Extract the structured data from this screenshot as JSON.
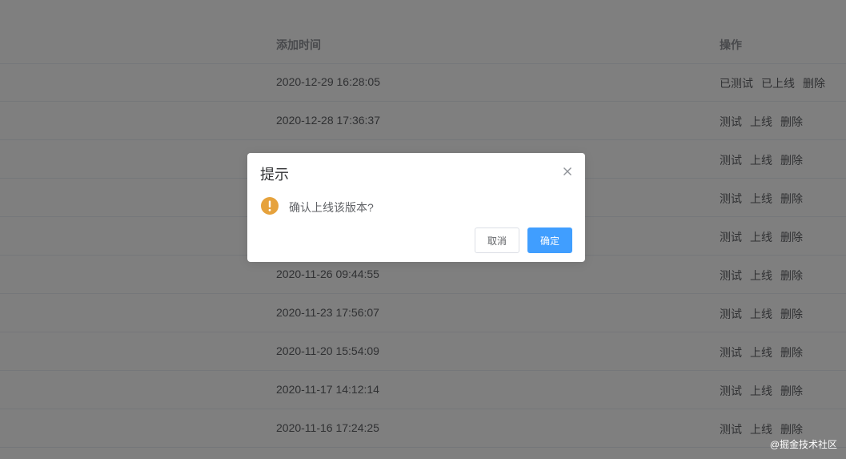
{
  "table": {
    "columns": {
      "time": "添加时间",
      "ops": "操作"
    },
    "rows": [
      {
        "time": "2020-12-29 16:28:05",
        "ops": [
          "已测试",
          "已上线",
          "删除"
        ]
      },
      {
        "time": "2020-12-28 17:36:37",
        "ops": [
          "测试",
          "上线",
          "删除"
        ]
      },
      {
        "time": "",
        "ops": [
          "测试",
          "上线",
          "删除"
        ]
      },
      {
        "time": "",
        "ops": [
          "测试",
          "上线",
          "删除"
        ]
      },
      {
        "time": "",
        "ops": [
          "测试",
          "上线",
          "删除"
        ]
      },
      {
        "time": "2020-11-26 09:44:55",
        "ops": [
          "测试",
          "上线",
          "删除"
        ]
      },
      {
        "time": "2020-11-23 17:56:07",
        "ops": [
          "测试",
          "上线",
          "删除"
        ]
      },
      {
        "time": "2020-11-20 15:54:09",
        "ops": [
          "测试",
          "上线",
          "删除"
        ]
      },
      {
        "time": "2020-11-17 14:12:14",
        "ops": [
          "测试",
          "上线",
          "删除"
        ]
      },
      {
        "time": "2020-11-16 17:24:25",
        "ops": [
          "测试",
          "上线",
          "删除"
        ]
      }
    ]
  },
  "dialog": {
    "title": "提示",
    "message": "确认上线该版本?",
    "cancel_label": "取消",
    "confirm_label": "确定",
    "icon": "warning-icon",
    "close_icon": "close-icon"
  },
  "colors": {
    "primary": "#409eff",
    "warning": "#e6a23c"
  },
  "watermark": "@掘金技术社区"
}
